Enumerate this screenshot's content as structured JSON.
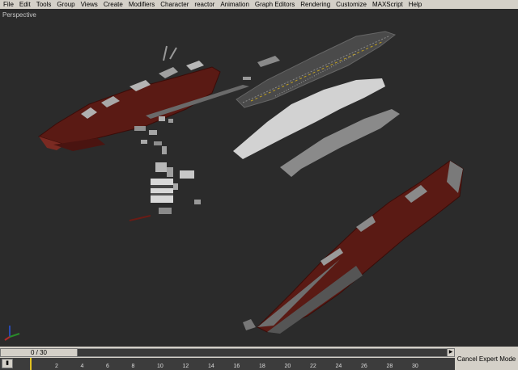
{
  "menu": [
    "File",
    "Edit",
    "Tools",
    "Group",
    "Views",
    "Create",
    "Modifiers",
    "Character",
    "reactor",
    "Animation",
    "Graph Editors",
    "Rendering",
    "Customize",
    "MAXScript",
    "Help"
  ],
  "viewport": {
    "label": "Perspective"
  },
  "timeline": {
    "frame_readout": "0 / 30",
    "prev_icon": "arrow-left-icon",
    "next_icon": "arrow-right-icon",
    "key_icon": "key-filter-icon",
    "ticks": [
      "2",
      "4",
      "6",
      "8",
      "10",
      "12",
      "14",
      "16",
      "18",
      "20",
      "22",
      "24",
      "26",
      "28",
      "30"
    ]
  },
  "status": {
    "cancel_expert_label": "Cancel Expert Mode"
  },
  "colors": {
    "hull_red": "#5a1a14",
    "hull_grey": "#8a8a8a",
    "deck_light": "#c8c8c8",
    "ui_grey": "#d4d0c8"
  }
}
